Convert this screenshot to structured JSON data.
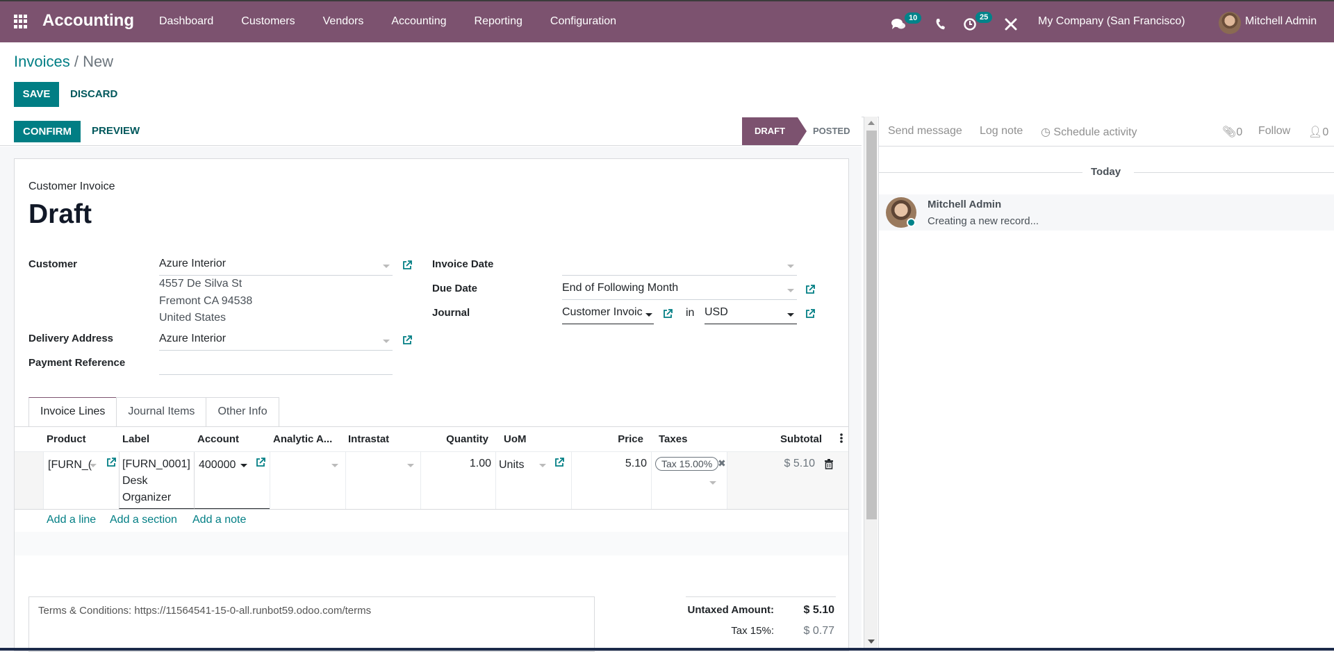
{
  "navbar": {
    "app_name": "Accounting",
    "menu": [
      "Dashboard",
      "Customers",
      "Vendors",
      "Accounting",
      "Reporting",
      "Configuration"
    ],
    "messages_count": "10",
    "activities_count": "25",
    "company": "My Company (San Francisco)",
    "user": "Mitchell Admin",
    "icons": [
      "apps-grid-icon",
      "chat-icon",
      "phone-icon",
      "activity-clock-icon",
      "debug-tools-icon"
    ]
  },
  "breadcrumb": {
    "parent": "Invoices",
    "separator": " / ",
    "current": "New"
  },
  "control": {
    "save": "Save",
    "discard": "Discard"
  },
  "statusbar": {
    "confirm": "Confirm",
    "preview": "Preview",
    "stages": [
      {
        "label": "DRAFT",
        "active": true
      },
      {
        "label": "POSTED",
        "active": false
      }
    ]
  },
  "form": {
    "type_label": "Customer Invoice",
    "name": "Draft",
    "left": {
      "customer_label": "Customer",
      "customer_value": "Azure Interior",
      "address": [
        "4557 De Silva St",
        "Fremont CA 94538",
        "United States"
      ],
      "delivery_label": "Delivery Address",
      "delivery_value": "Azure Interior",
      "payment_ref_label": "Payment Reference",
      "payment_ref_value": ""
    },
    "right": {
      "invoice_date_label": "Invoice Date",
      "invoice_date_value": "",
      "due_date_label": "Due Date",
      "due_date_value": "End of Following Month",
      "journal_label": "Journal",
      "journal_value": "Customer Invoices",
      "journal_display": "Customer Invoic",
      "in_text": "in",
      "currency_value": "USD"
    },
    "tabs": [
      {
        "label": "Invoice Lines",
        "active": true
      },
      {
        "label": "Journal Items",
        "active": false
      },
      {
        "label": "Other Info",
        "active": false
      }
    ],
    "lines": {
      "columns": [
        "Product",
        "Label",
        "Account",
        "Analytic A...",
        "Intrastat",
        "Quantity",
        "UoM",
        "Price",
        "Taxes",
        "Subtotal"
      ],
      "rows": [
        {
          "product": "[FURN_0001] Desk Organizer",
          "product_display": "[FURN_(",
          "label_lines": [
            "[FURN_0001]",
            "Desk",
            "Organizer"
          ],
          "account": "400000",
          "analytic": "",
          "intrastat": "",
          "quantity": "1.00",
          "uom": "Units",
          "price": "5.10",
          "taxes": [
            "Tax 15.00%"
          ],
          "subtotal": "$ 5.10"
        }
      ],
      "add_links": [
        "Add a line",
        "Add a section",
        "Add a note"
      ]
    },
    "terms": "Terms & Conditions: https://11564541-15-0-all.runbot59.odoo.com/terms",
    "totals": [
      {
        "label": "Untaxed Amount:",
        "value": "$ 5.10"
      },
      {
        "label": "Tax 15%:",
        "value": "$ 0.77"
      }
    ]
  },
  "chatter": {
    "send_message": "Send message",
    "log_note": "Log note",
    "schedule_activity": "Schedule activity",
    "attachments_count": "0",
    "follow": "Follow",
    "followers_count": "0",
    "date_separator": "Today",
    "messages": [
      {
        "author": "Mitchell Admin",
        "body": "Creating a new record..."
      }
    ]
  }
}
